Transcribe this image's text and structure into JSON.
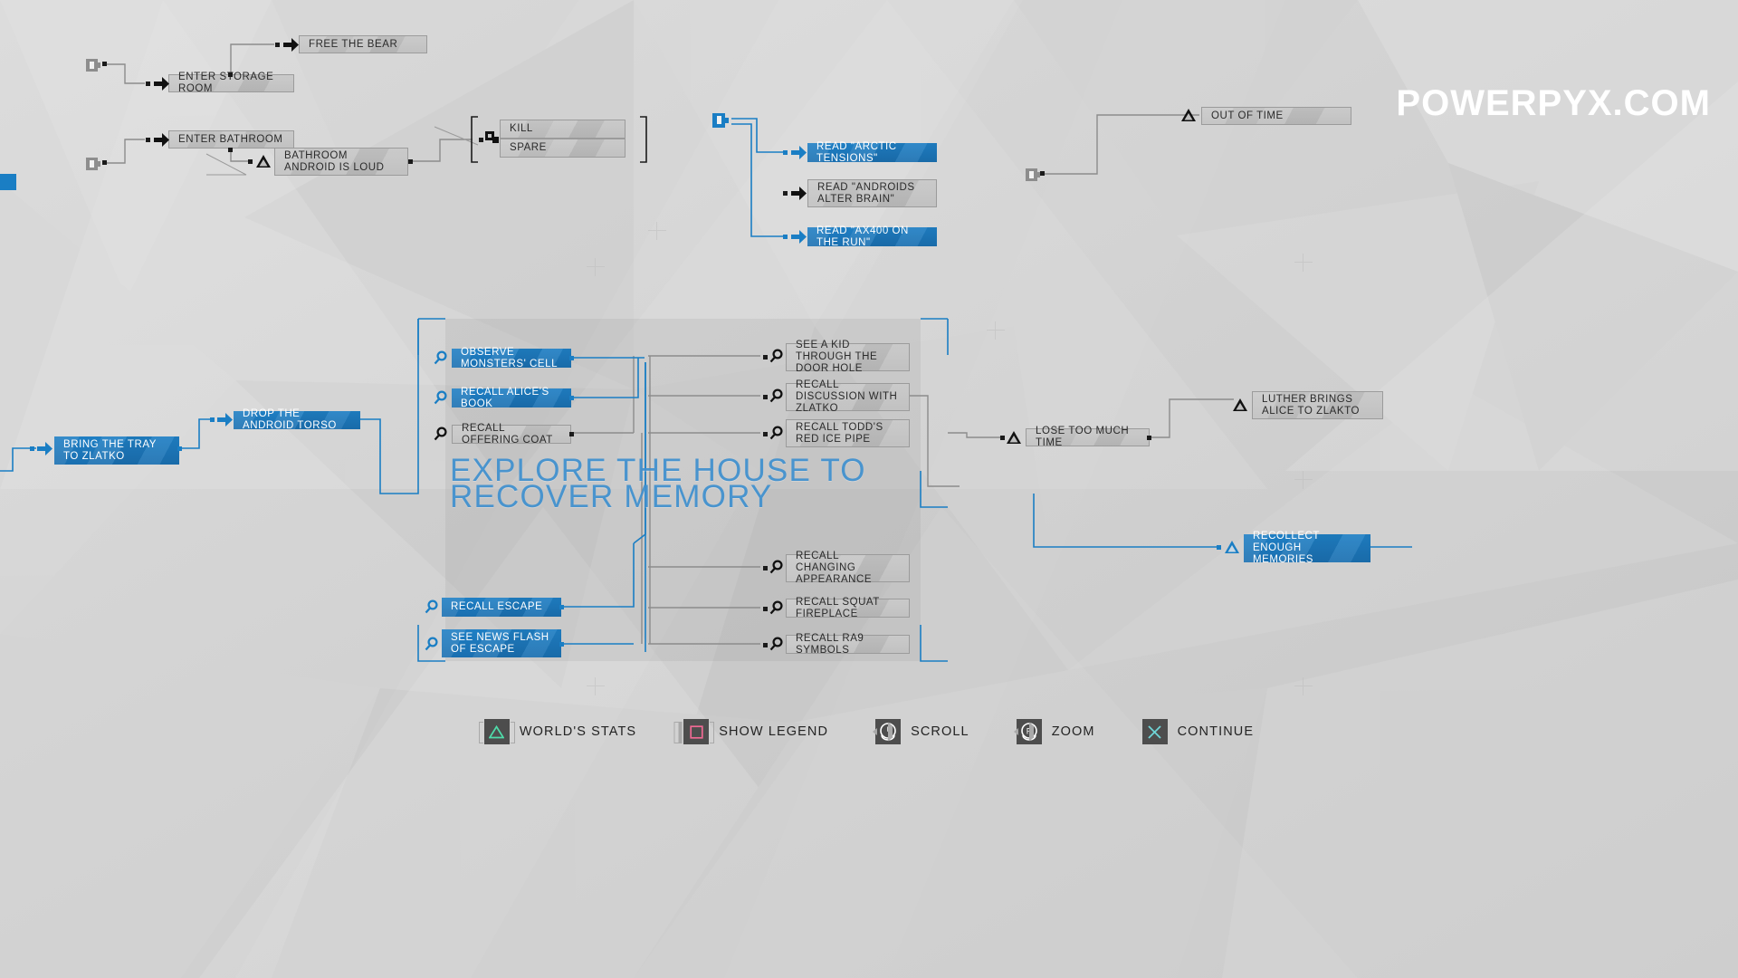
{
  "watermark": "POWERPYX.COM",
  "section_title": "EXPLORE THE HOUSE TO\nRECOVER MEMORY",
  "nodes": {
    "free_the_bear": "FREE THE BEAR",
    "enter_storage_room": "ENTER STORAGE ROOM",
    "enter_bathroom": "ENTER BATHROOM",
    "bathroom_android_is_loud": "BATHROOM ANDROID IS LOUD",
    "kill": "KILL",
    "spare": "SPARE",
    "read_arctic_tensions": "READ \"ARCTIC TENSIONS\"",
    "read_androids_alter_brain": "READ \"ANDROIDS ALTER BRAIN\"",
    "read_ax400_on_the_run": "READ \"AX400 ON THE RUN\"",
    "out_of_time": "OUT OF TIME",
    "bring_the_tray_to_zlatko": "BRING THE TRAY TO ZLATKO",
    "drop_the_android_torso": "DROP THE ANDROID TORSO",
    "observe_monsters_cell": "OBSERVE MONSTERS' CELL",
    "recall_alices_book": "RECALL ALICE'S BOOK",
    "recall_offering_coat": "RECALL OFFERING COAT",
    "see_a_kid_through_the_door_hole": "SEE A KID THROUGH THE DOOR HOLE",
    "recall_discussion_with_zlatko": "RECALL DISCUSSION WITH ZLATKO",
    "recall_todds_red_ice_pipe": "RECALL TODD'S RED ICE PIPE",
    "recall_changing_appearance": "RECALL CHANGING APPEARANCE",
    "recall_squat_fireplace": "RECALL SQUAT FIREPLACE",
    "recall_ra9_symbols": "RECALL RA9 SYMBOLS",
    "recall_escape": "RECALL ESCAPE",
    "see_news_flash_of_escape": "SEE NEWS FLASH OF ESCAPE",
    "lose_too_much_time": "LOSE TOO MUCH TIME",
    "luther_brings_alice_to_zlatko": "LUTHER BRINGS ALICE TO ZLAKTO",
    "recollect_enough_memories": "RECOLLECT ENOUGH MEMORIES"
  },
  "controls": [
    {
      "icon": "triangle-button-icon",
      "label": "WORLD'S STATS"
    },
    {
      "icon": "square-button-icon",
      "label": "SHOW LEGEND"
    },
    {
      "icon": "left-stick-icon",
      "label": "SCROLL"
    },
    {
      "icon": "right-stick-icon",
      "label": "ZOOM"
    },
    {
      "icon": "cross-button-icon",
      "label": "CONTINUE"
    }
  ],
  "colors": {
    "accent_blue": "#1a7ec4",
    "title_blue": "#3f90cf",
    "node_grey": "#bdbdbd",
    "triangle_green": "#4fdcaa",
    "square_pink": "#f06a94",
    "cross_cyan": "#6fd4d6",
    "background": "#d2d2d2"
  }
}
